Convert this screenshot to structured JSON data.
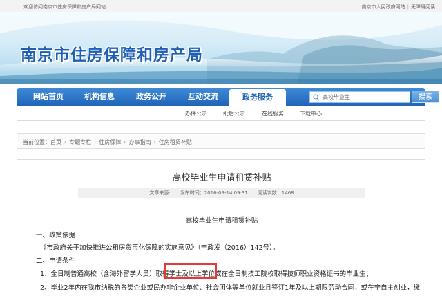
{
  "topbar": {
    "welcome": "欢迎访问南京市住房保障和房产局网站",
    "gov_link": "南京市人民政府网站",
    "separator": "|",
    "accessibility": "无障碍阅读"
  },
  "site": {
    "title": "南京市住房保障和房产局"
  },
  "nav": {
    "items": [
      {
        "label": "网站首页"
      },
      {
        "label": "机构信息"
      },
      {
        "label": "政务公开"
      },
      {
        "label": "互动交流"
      },
      {
        "label": "政务服务"
      }
    ],
    "active_index": 4,
    "search": {
      "value": "高校毕业生",
      "button": "搜索"
    }
  },
  "subnav": {
    "items": [
      {
        "label": "办件公示"
      },
      {
        "label": "批后公示"
      },
      {
        "label": "在线服务"
      },
      {
        "label": "下载中心"
      }
    ]
  },
  "breadcrumb": {
    "prefix": "当前位置：",
    "items": [
      "首页",
      "专题专栏",
      "住房保障",
      "办事指南",
      "住房租赁补贴"
    ],
    "arrow": "›"
  },
  "article": {
    "title": "高校毕业生申请租赁补贴",
    "meta": {
      "source": "文章来源:",
      "date": "发布时间：2016-09-14 09:31",
      "views": "阅读次数：1468"
    },
    "content_title": "高校毕业生申请租赁补贴",
    "section1": "一、政策依据",
    "policy_ref": "《市政府关于加快推进公租房货币化保障的实施意见》（宁政发（2016）142号）。",
    "section2": "二、申请条件",
    "cond1_pre": "1、全日制普通高校（含海外留学人员）取得",
    "cond1_mid": "学士及以上学位",
    "cond1_post": "或在全日制技工院校取得技师职业资格证书的毕业生；",
    "cond2": "2、毕业2年内在我市纳税的各类企业或民办非企业单位、社会团体等单位就业且签订1年及以上期限劳动合同，或在宁自主创业，缴"
  },
  "colors": {
    "brand_blue": "#1f64b8",
    "highlight_red": "#e53935"
  }
}
